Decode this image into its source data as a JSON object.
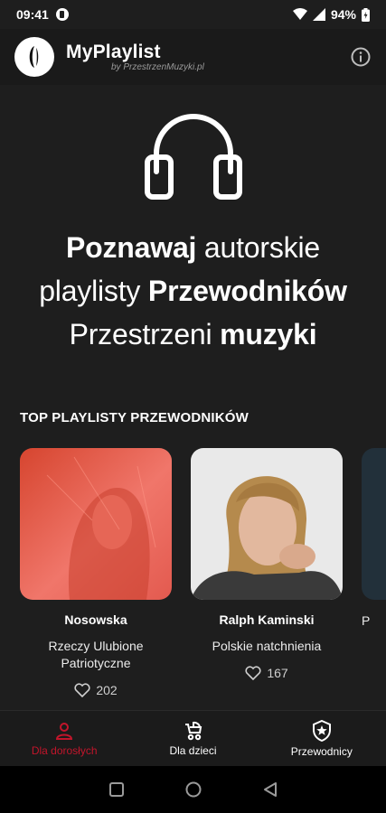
{
  "status_bar": {
    "time": "09:41",
    "battery": "94%"
  },
  "header": {
    "app_name": "MyPlaylist",
    "subtitle": "by PrzestrzenMuzyki.pl"
  },
  "hero": {
    "line1_bold": "Poznawaj",
    "line1_rest": " autorskie",
    "line2_start": "playlisty ",
    "line2_bold": "Przewodników",
    "line3_start": "Przestrzeni ",
    "line3_bold": "muzyki"
  },
  "section": {
    "title": "TOP PLAYLISTY PRZEWODNIKÓW"
  },
  "cards": [
    {
      "name": "Nosowska",
      "description": "Rzeczy Ulubione Patriotyczne",
      "likes": "202"
    },
    {
      "name": "Ralph Kaminski",
      "description": "Polskie natchnienia",
      "likes": "167"
    },
    {
      "name": "",
      "description": "P",
      "likes": ""
    }
  ],
  "bottom_nav": [
    {
      "label": "Dla dorosłych",
      "icon": "person-icon",
      "active": true
    },
    {
      "label": "Dla dzieci",
      "icon": "stroller-icon",
      "active": false
    },
    {
      "label": "Przewodnicy",
      "icon": "shield-star-icon",
      "active": false
    }
  ],
  "colors": {
    "accent": "#c2152b",
    "background": "#1e1e1e",
    "card1_tint": "#e8604f"
  }
}
